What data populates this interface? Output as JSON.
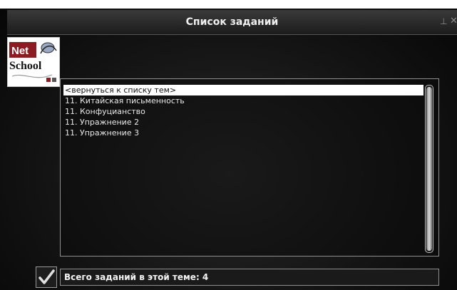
{
  "window": {
    "title": "Список заданий"
  },
  "logo": {
    "line1": "Net",
    "line2": "School"
  },
  "task_list": {
    "items": [
      "<вернуться к списку тем>",
      "11. Китайская письменность",
      "11. Конфуцианство",
      "11. Упражнение 2",
      "11. Упражнение 3"
    ],
    "selected_index": 0
  },
  "status": {
    "text": "Всего заданий в этой теме: 4"
  },
  "icons": {
    "pin": "pin-icon",
    "close": "close-icon",
    "check": "checkmark-icon",
    "logo": "netschool-logo"
  },
  "colors": {
    "window_bg": "#141414",
    "title_text": "#f0f0f0",
    "list_text": "#e8e8e8",
    "selected_bg": "#ffffff",
    "border": "#8e8e8e"
  }
}
